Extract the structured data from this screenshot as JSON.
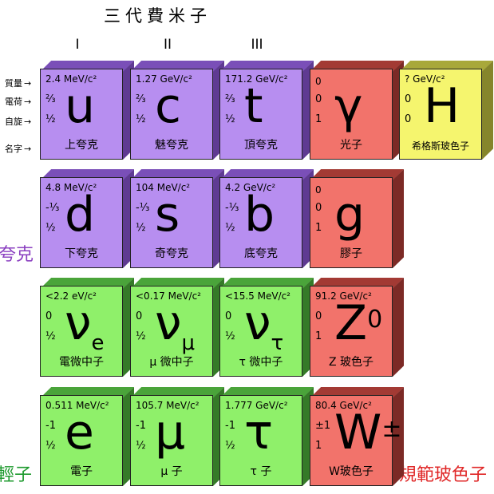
{
  "title": "三代費米子",
  "generations": [
    "I",
    "II",
    "III"
  ],
  "legend": {
    "mass": "質量",
    "charge": "電荷",
    "spin": "自旋",
    "name": "名字",
    "arrow": "→"
  },
  "groups": {
    "quarks": "夸克",
    "leptons": "輕子",
    "bosons": "規範玻色子"
  },
  "particles": {
    "up": {
      "mass": "2.4 MeV/c²",
      "charge": "⅔",
      "spin": "½",
      "symbol": "u",
      "name": "上夸克"
    },
    "charm": {
      "mass": "1.27 GeV/c²",
      "charge": "⅔",
      "spin": "½",
      "symbol": "c",
      "name": "魅夸克"
    },
    "top": {
      "mass": "171.2 GeV/c²",
      "charge": "⅔",
      "spin": "½",
      "symbol": "t",
      "name": "頂夸克"
    },
    "photon": {
      "mass": "0",
      "charge": "0",
      "spin": "1",
      "symbol": "γ",
      "name": "光子"
    },
    "higgs": {
      "mass": "? GeV/c²",
      "charge": "0",
      "spin": "0",
      "symbol": "H",
      "name": "希格斯玻色子"
    },
    "down": {
      "mass": "4.8 MeV/c²",
      "charge": "-⅓",
      "spin": "½",
      "symbol": "d",
      "name": "下夸克"
    },
    "strange": {
      "mass": "104 MeV/c²",
      "charge": "-⅓",
      "spin": "½",
      "symbol": "s",
      "name": "奇夸克"
    },
    "bottom": {
      "mass": "4.2 GeV/c²",
      "charge": "-⅓",
      "spin": "½",
      "symbol": "b",
      "name": "底夸克"
    },
    "gluon": {
      "mass": "0",
      "charge": "0",
      "spin": "1",
      "symbol": "g",
      "name": "膠子"
    },
    "nu_e": {
      "mass": "<2.2 eV/c²",
      "charge": "0",
      "spin": "½",
      "symbol": "ν",
      "sub": "e",
      "name": "電微中子"
    },
    "nu_mu": {
      "mass": "<0.17 MeV/c²",
      "charge": "0",
      "spin": "½",
      "symbol": "ν",
      "sub": "μ",
      "name": "μ 微中子"
    },
    "nu_tau": {
      "mass": "<15.5 MeV/c²",
      "charge": "0",
      "spin": "½",
      "symbol": "ν",
      "sub": "τ",
      "name": "τ 微中子"
    },
    "z": {
      "mass": "91.2 GeV/c²",
      "charge": "0",
      "spin": "1",
      "symbol": "Z",
      "sup": "0",
      "name": "Z 玻色子"
    },
    "electron": {
      "mass": "0.511 MeV/c²",
      "charge": "-1",
      "spin": "½",
      "symbol": "e",
      "name": "電子"
    },
    "muon": {
      "mass": "105.7 MeV/c²",
      "charge": "-1",
      "spin": "½",
      "symbol": "μ",
      "name": "μ 子"
    },
    "tau": {
      "mass": "1.777 GeV/c²",
      "charge": "-1",
      "spin": "½",
      "symbol": "τ",
      "name": "τ 子"
    },
    "w": {
      "mass": "80.4 GeV/c²",
      "charge": "±1",
      "spin": "1",
      "symbol": "W",
      "sup": "±",
      "name": "W玻色子"
    }
  }
}
